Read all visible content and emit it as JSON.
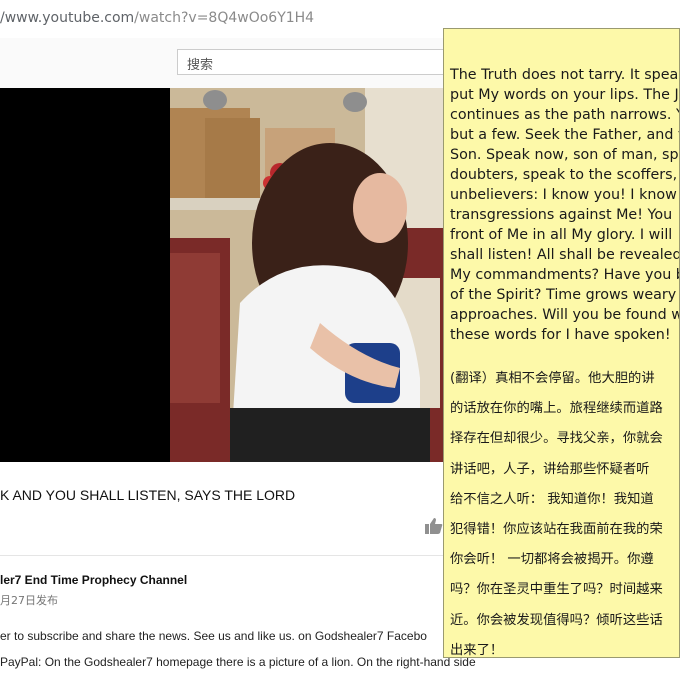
{
  "browser": {
    "url_host": "/www.youtube.com",
    "url_path": "/watch?v=8Q4wOo6Y1H4"
  },
  "header": {
    "search_placeholder": "搜索"
  },
  "video": {
    "title": "K AND YOU SHALL LISTEN, SAYS THE LORD"
  },
  "channel": {
    "name": "ler7 End Time Prophecy Channel",
    "published": "月27日发布"
  },
  "description": {
    "lines": [
      "er to subscribe and share the news. See us and like us.  on Godshealer7 Facebo",
      "PayPal: On the Godshealer7 homepage there is a picture of a lion. On the right-hand side"
    ]
  },
  "note": {
    "english_lines": [
      "The Truth does not tarry. It spea",
      "put My words on your lips. The J",
      "continues as the path narrows. Y",
      "but a few. Seek the Father, and y",
      "Son. Speak now, son of man, spe",
      "doubters, speak to the scoffers,",
      "unbelievers: I know you! I know",
      "transgressions against Me! You",
      "front of Me in all My glory. I will",
      "shall listen! All shall be revealed",
      "My commandments? Have you b",
      "of the Spirit? Time grows weary",
      "approaches. Will you be found w",
      "these words for I have spoken!"
    ],
    "chinese_lines": [
      "(翻译）真相不会停留。他大胆的讲",
      "的话放在你的嘴上。旅程继续而道路",
      "择存在但却很少。寻找父亲，你就会",
      "讲话吧，人子，讲给那些怀疑者听",
      "给不信之人听： 我知道你！我知道",
      "犯得错！你应该站在我面前在我的荣",
      "你会听！ 一切都将会被揭开。你遵",
      "吗？你在圣灵中重生了吗？时间越来",
      "近。你会被发现值得吗？倾听这些话",
      "出来了！"
    ]
  },
  "colors": {
    "note_bg": "#fdf9a9",
    "video_bg": "#000000",
    "url_text": "#5f6368"
  }
}
